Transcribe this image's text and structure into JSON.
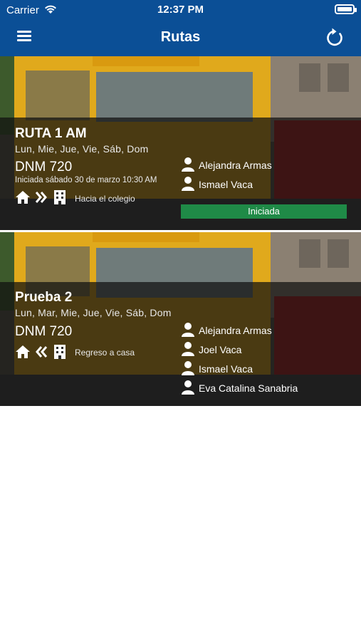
{
  "status_bar": {
    "carrier": "Carrier",
    "time": "12:37 PM"
  },
  "header": {
    "title": "Rutas"
  },
  "routes": [
    {
      "name": "RUTA 1 AM",
      "days": "Lun, Mie, Jue, Vie, Sáb, Dom",
      "plate": "DNM 720",
      "started_text": "Iniciada sábado 30 de marzo 10:30 AM",
      "direction_label": "Hacia el colegio",
      "passengers": [
        "Alejandra Armas",
        "Ismael Vaca"
      ],
      "status": "Iniciada"
    },
    {
      "name": "Prueba 2",
      "days": "Lun, Mar, Mie, Jue, Vie, Sáb, Dom",
      "plate": "DNM 720",
      "direction_label": "Regreso a casa",
      "passengers": [
        "Alejandra Armas",
        "Joel Vaca",
        "Ismael Vaca",
        "Eva Catalina Sanabria"
      ]
    }
  ],
  "colors": {
    "header": "#0b4f96",
    "status_started": "#1f8a47"
  }
}
